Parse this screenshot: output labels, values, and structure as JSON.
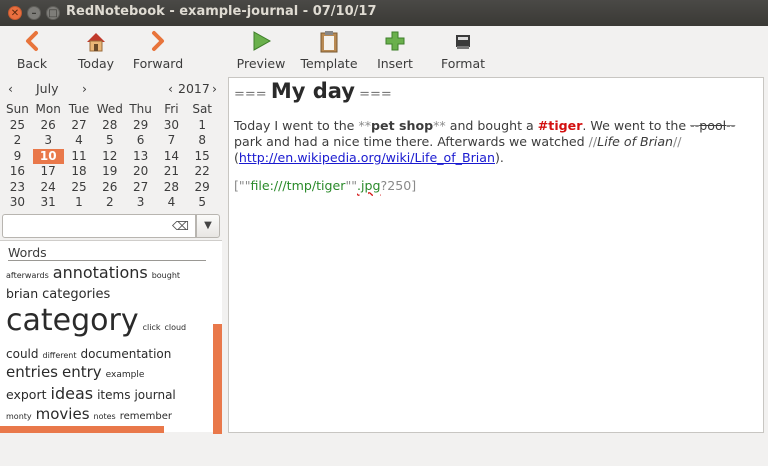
{
  "window": {
    "title": "RedNotebook - example-journal - 07/10/17",
    "close_glyph": "✕",
    "min_glyph": "–",
    "max_glyph": "□"
  },
  "toolbar": {
    "back": "Back",
    "today": "Today",
    "forward": "Forward",
    "preview": "Preview",
    "template": "Template",
    "insert": "Insert",
    "format": "Format"
  },
  "calendar": {
    "month": "July",
    "year": "2017",
    "prev_glyph": "‹",
    "next_glyph": "›",
    "weekdays": [
      "Sun",
      "Mon",
      "Tue",
      "Wed",
      "Thu",
      "Fri",
      "Sat"
    ],
    "weeks": [
      [
        "25",
        "26",
        "27",
        "28",
        "29",
        "30",
        "1"
      ],
      [
        "2",
        "3",
        "4",
        "5",
        "6",
        "7",
        "8"
      ],
      [
        "9",
        "10",
        "11",
        "12",
        "13",
        "14",
        "15"
      ],
      [
        "16",
        "17",
        "18",
        "19",
        "20",
        "21",
        "22"
      ],
      [
        "23",
        "24",
        "25",
        "26",
        "27",
        "28",
        "29"
      ],
      [
        "30",
        "31",
        "1",
        "2",
        "3",
        "4",
        "5"
      ]
    ],
    "selected_day": "10"
  },
  "search": {
    "value": "",
    "clear_glyph": "⌫",
    "dropdown_glyph": "▼"
  },
  "words": {
    "title": "Words",
    "lines": [
      [
        {
          "t": "afterwards",
          "s": 8
        },
        {
          "t": "annotations",
          "s": 16
        },
        {
          "t": "bought",
          "s": 8
        }
      ],
      [
        {
          "t": "brian",
          "s": 12.5
        },
        {
          "t": "categories",
          "s": 13
        }
      ],
      [
        {
          "t": "category",
          "s": 30
        },
        {
          "t": "click",
          "s": 8
        },
        {
          "t": "cloud",
          "s": 8
        }
      ],
      [
        {
          "t": "could",
          "s": 12
        },
        {
          "t": "different",
          "s": 8
        },
        {
          "t": "documentation",
          "s": 12
        }
      ],
      [
        {
          "t": "entries",
          "s": 15
        },
        {
          "t": "entry",
          "s": 15
        },
        {
          "t": "example",
          "s": 9
        }
      ],
      [
        {
          "t": "export",
          "s": 12.5
        },
        {
          "t": "ideas",
          "s": 16
        },
        {
          "t": "items",
          "s": 12
        },
        {
          "t": "journal",
          "s": 12
        }
      ],
      [
        {
          "t": "monty",
          "s": 8
        },
        {
          "t": "movies",
          "s": 15
        },
        {
          "t": "notes",
          "s": 8
        },
        {
          "t": "remember",
          "s": 10
        }
      ]
    ]
  },
  "editor": {
    "heading_markup_open": "===",
    "heading": "My day",
    "heading_markup_close": "===",
    "text_1": "Today I went to the ",
    "bold_mark": "**",
    "bold_text": "pet shop",
    "text_2": " and bought a ",
    "tag": "#tiger",
    "text_3": ". We went to the ",
    "strike_mark": "--",
    "strike_text": "pool",
    "text_4": " park and had a nice time there. Afterwards we watched ",
    "italic_mark": "//",
    "italic_text": "Life of Brian",
    "text_5": " (",
    "link": "http://en.wikipedia.org/wiki/Life_of_Brian",
    "text_6": ").",
    "img_open": "[\"\"",
    "img_path": "file:///tmp/tiger",
    "img_mid": "\"\"",
    "img_ext": ".jpg",
    "img_tail": "?250]"
  }
}
